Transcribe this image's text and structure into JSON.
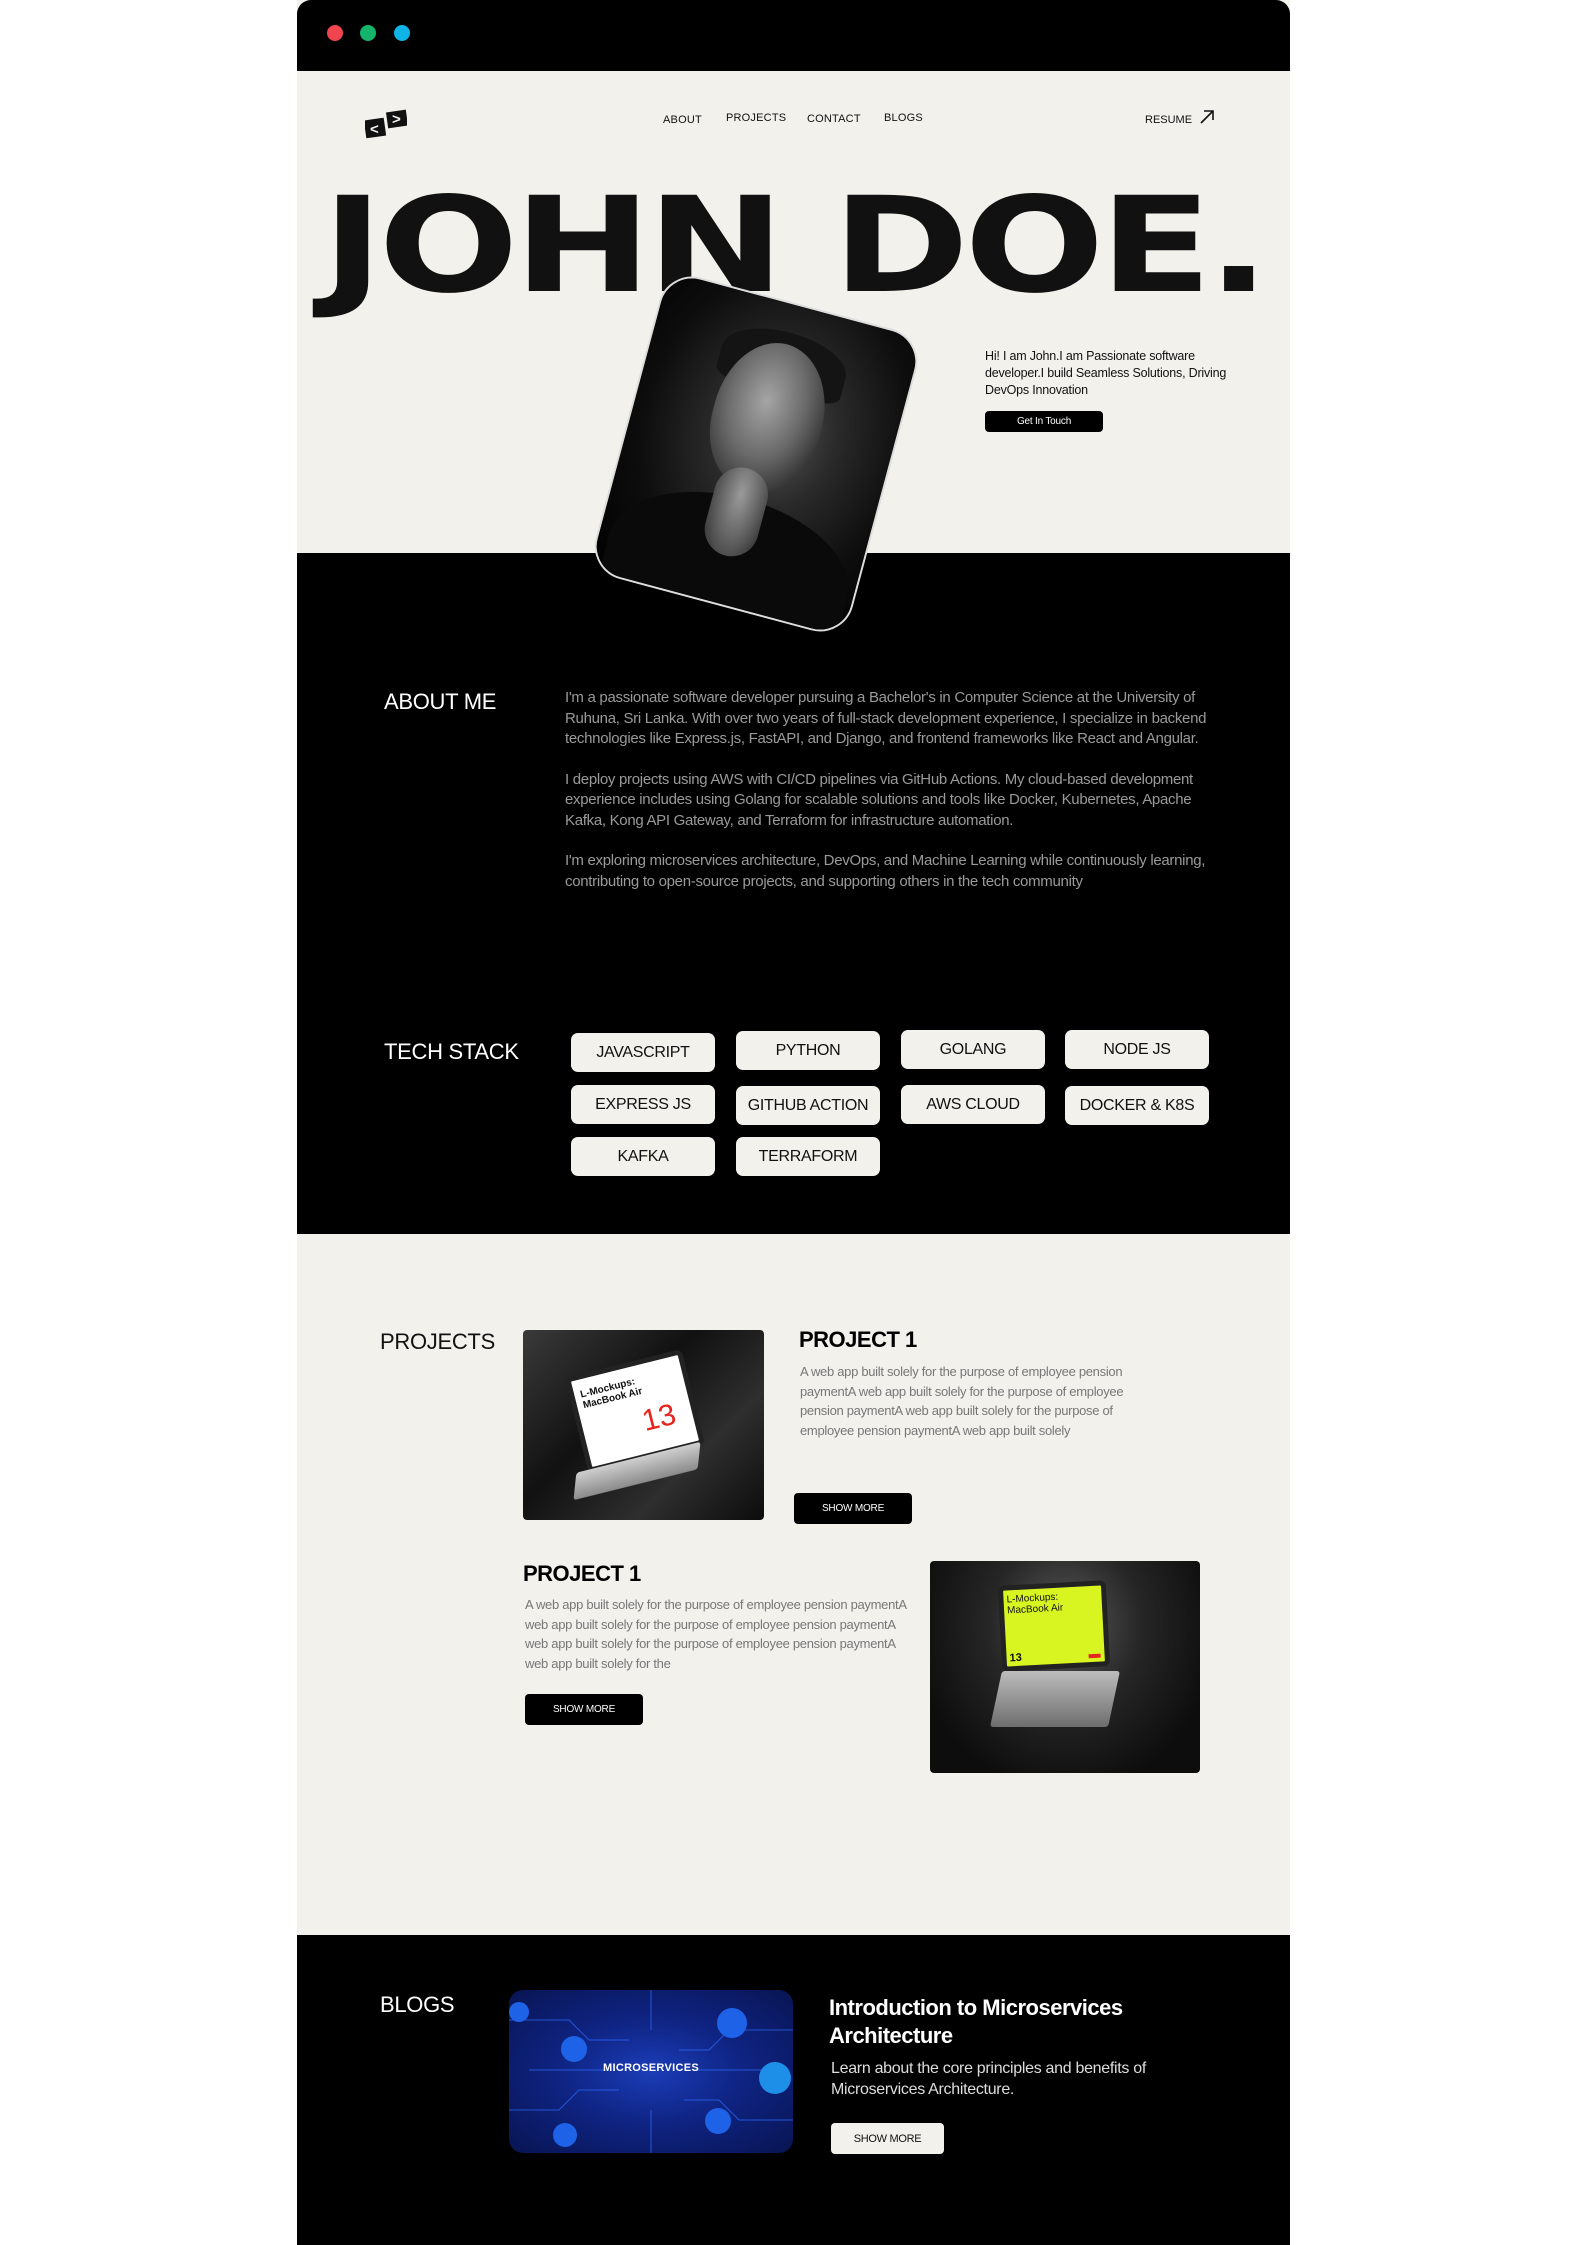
{
  "window": {
    "dot_colors": [
      "#f0454f",
      "#14b56a",
      "#10b3e6"
    ]
  },
  "header": {
    "logo_icon": "code-brackets-icon",
    "nav": [
      "ABOUT",
      "PROJECTS",
      "CONTACT",
      "BLOGS"
    ],
    "resume_label": "RESUME",
    "resume_icon": "arrow-up-right-icon"
  },
  "hero": {
    "name": "JOHN DOE.",
    "intro": "Hi! I am John.I am Passionate software developer.I build  Seamless Solutions, Driving DevOps Innovation",
    "cta_label": "Get In Touch"
  },
  "about": {
    "title": "ABOUT ME",
    "paragraphs": [
      "I'm a passionate software developer pursuing a Bachelor's in Computer Science at the University of Ruhuna, Sri Lanka. With over two years of full-stack development experience, I specialize in backend technologies like Express.js, FastAPI, and Django, and frontend frameworks like React and Angular.",
      "I deploy projects using AWS with CI/CD pipelines via GitHub Actions. My cloud-based development experience includes using Golang for scalable solutions and tools like Docker, Kubernetes, Apache Kafka, Kong API Gateway, and Terraform for infrastructure automation.",
      "I'm exploring microservices architecture, DevOps, and Machine Learning while continuously learning, contributing to open-source projects, and supporting others in the tech community"
    ]
  },
  "tech_stack": {
    "title": "TECH STACK",
    "items": [
      "JAVASCRIPT",
      "PYTHON",
      "GOLANG",
      "NODE JS",
      "EXPRESS JS",
      "GITHUB ACTION",
      "AWS CLOUD",
      "DOCKER & K8S",
      "KAFKA",
      "TERRAFORM"
    ]
  },
  "projects": {
    "title": "PROJECTS",
    "items": [
      {
        "title": "PROJECT 1",
        "description": "A web app built solely for the purpose of employee pension paymentA web app built solely for the purpose of employee pension paymentA web app built solely for the purpose of employee pension paymentA web app built solely",
        "button": "SHOW MORE",
        "mockup_text": "L-Mockups: MacBook Air",
        "mockup_number": "13"
      },
      {
        "title": "PROJECT 1",
        "description": "A web app built solely for the purpose of employee pension paymentA web app built solely for the purpose of employee pension paymentA web app built solely for the purpose of employee pension paymentA web app built solely for the",
        "button": "SHOW MORE",
        "mockup_text": "L-Mockups: MacBook Air",
        "mockup_number": "13"
      }
    ]
  },
  "blogs": {
    "title": "BLOGS",
    "items": [
      {
        "image_label": "MICROSERVICES",
        "title": "Introduction to Microservices Architecture",
        "description": "Learn about the core principles and benefits of Microservices Architecture.",
        "button": "SHOW MORE"
      }
    ]
  }
}
